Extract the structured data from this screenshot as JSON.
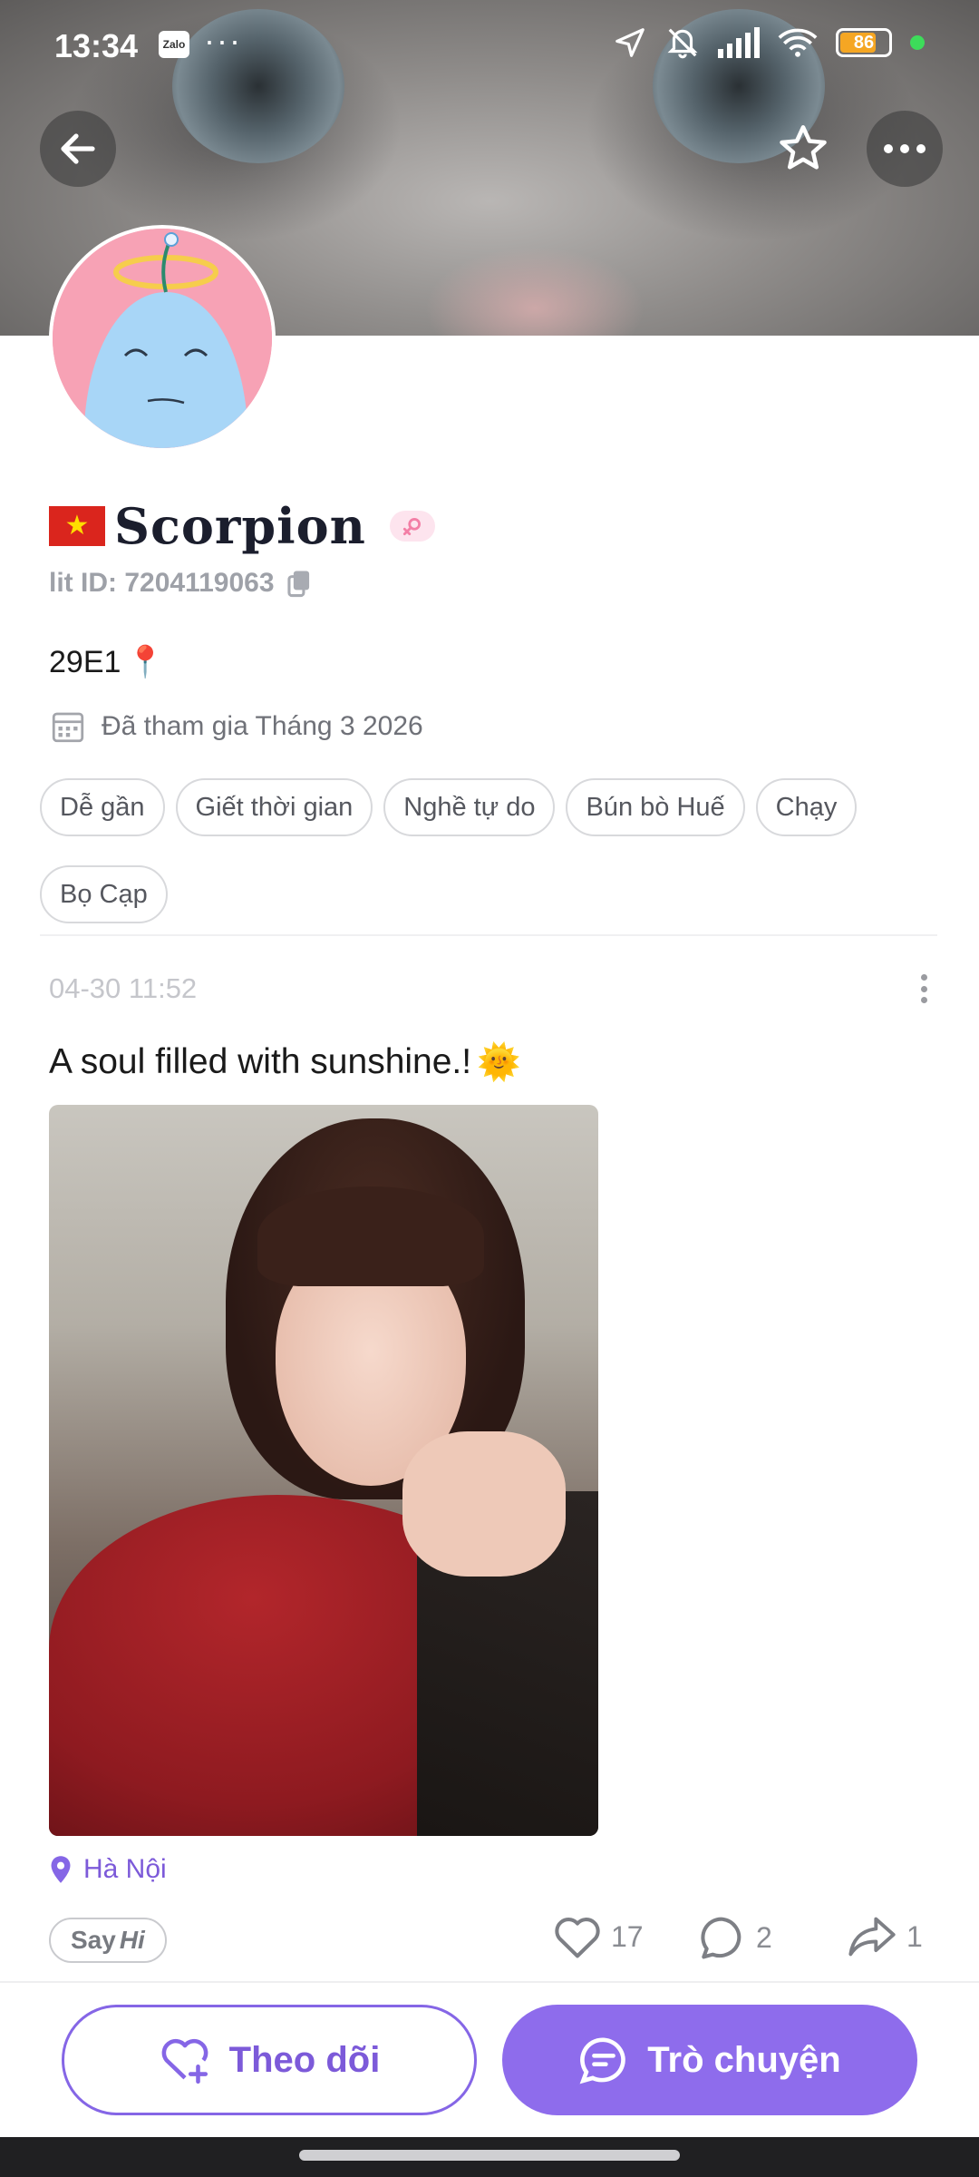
{
  "status_bar": {
    "time": "13:34",
    "app_badge": "Zalo",
    "more": "···",
    "battery": "86",
    "icons": [
      "location-arrow-icon",
      "bell-off-icon",
      "signal-icon",
      "wifi-icon",
      "battery-icon"
    ]
  },
  "header": {
    "back_icon": "back-arrow-icon",
    "favorite_icon": "star-icon",
    "more_icon": "more-dots-icon"
  },
  "profile": {
    "flag": "🇻🇳",
    "name": "Scorpion",
    "gender_icon": "female-icon",
    "lit_id": "lit ID: 7204119063",
    "bio_text": "29E1",
    "bio_emoji": "📍",
    "joined": "Đã tham gia Tháng 3 2026",
    "tags": [
      "Dễ gần",
      "Giết thời gian",
      "Nghề tự do",
      "Bún bò Huế",
      "Chạy",
      "Bọ Cạp"
    ]
  },
  "post": {
    "time": "04-30 11:52",
    "text": "A soul filled with sunshine.!",
    "emoji": "🌞",
    "location": "Hà Nội",
    "say_hi": {
      "say": "Say",
      "hi": "Hi"
    },
    "likes": "17",
    "comments": "2",
    "shares": "1"
  },
  "bottom": {
    "follow_label": "Theo dõi",
    "chat_label": "Trò chuyện"
  },
  "colors": {
    "accent": "#8e6cec",
    "accent_text": "#7c5ad9",
    "flag_red": "#da251d",
    "muted": "#9ea1a8"
  }
}
